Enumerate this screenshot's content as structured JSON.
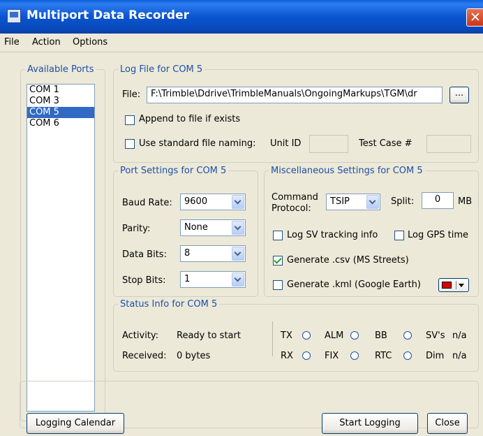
{
  "window": {
    "title": "Multiport Data Recorder",
    "close": "✕"
  },
  "menu": [
    "File",
    "Action",
    "Options"
  ],
  "ports": {
    "legend": "Available Ports",
    "items": [
      "COM 1",
      "COM 3",
      "COM 5",
      "COM 6"
    ],
    "selected": "COM 5"
  },
  "log": {
    "legend": "Log File for COM 5",
    "file_label": "File:",
    "file_value": "F:\\Trimble\\Ddrive\\TrimbleManuals\\OngoingMarkups\\TGM\\dr",
    "browse": "...",
    "append": {
      "label": "Append to file if exists",
      "checked": false
    },
    "standard": {
      "label": "Use standard file naming:",
      "checked": false
    },
    "unit_id_label": "Unit ID",
    "unit_id_value": "",
    "test_case_label": "Test Case #",
    "test_case_value": ""
  },
  "port_settings": {
    "legend": "Port Settings for COM 5",
    "baud": {
      "label": "Baud Rate:",
      "value": "9600"
    },
    "parity": {
      "label": "Parity:",
      "value": "None"
    },
    "data_bits": {
      "label": "Data Bits:",
      "value": "8"
    },
    "stop_bits": {
      "label": "Stop Bits:",
      "value": "1"
    }
  },
  "misc": {
    "legend": "Miscellaneous Settings for COM 5",
    "command_label_1": "Command",
    "command_label_2": "Protocol:",
    "protocol": "TSIP",
    "split_label": "Split:",
    "split_value": "0",
    "split_unit": "MB",
    "log_sv": {
      "label": "Log SV tracking info",
      "checked": false
    },
    "log_gps": {
      "label": "Log GPS time",
      "checked": false
    },
    "csv": {
      "label": "Generate .csv (MS Streets)",
      "checked": true
    },
    "kml": {
      "label": "Generate .kml (Google Earth)",
      "checked": false
    },
    "kml_color": "#d80000"
  },
  "status": {
    "legend": "Status Info for COM 5",
    "activity_label": "Activity:",
    "activity_value": "Ready to start",
    "received_label": "Received:",
    "received_value": "0 bytes",
    "indicators": {
      "tx": "TX",
      "alm": "ALM",
      "bb": "BB",
      "svs": "SV's",
      "svs_value": "n/a",
      "rx": "RX",
      "fix": "FIX",
      "rtc": "RTC",
      "dim": "Dim",
      "dim_value": "n/a"
    }
  },
  "buttons": {
    "calendar": "Logging Calendar",
    "start": "Start Logging",
    "close": "Close"
  }
}
